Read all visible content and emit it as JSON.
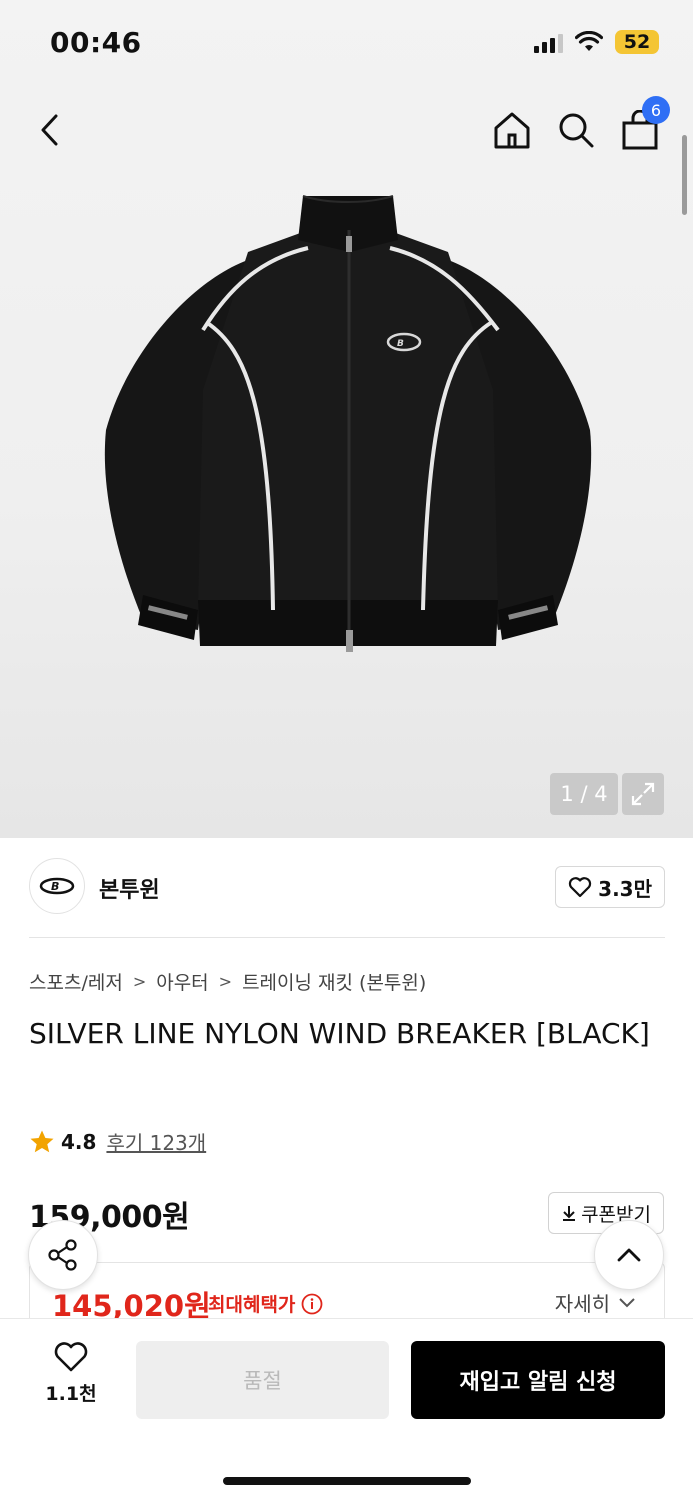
{
  "status_bar": {
    "time": "00:46",
    "battery": "52",
    "battery_color": "#f4c534"
  },
  "nav": {
    "cart_count": "6"
  },
  "gallery": {
    "page": "1 / 4"
  },
  "brand": {
    "name": "본투윈",
    "likes": "3.3만"
  },
  "breadcrumb": [
    "스포츠/레저",
    "아우터",
    "트레이닝 재킷 (본투윈)"
  ],
  "product": {
    "title": "SILVER LINE NYLON WIND BREAKER [BLACK]",
    "rating": "4.8",
    "reviews": "후기 123개",
    "price": "159,000원",
    "coupon_label": "쿠폰받기",
    "benefit_price": "145,020원",
    "benefit_label": "최대혜택가",
    "detail_label": "자세히"
  },
  "bottom_bar": {
    "wish_count": "1.1천",
    "soldout_label": "품절",
    "restock_label": "재입고 알림 신청"
  },
  "colors": {
    "accent_red": "#e0261b",
    "badge_blue": "#2f6ff5",
    "star": "#f2a300"
  }
}
